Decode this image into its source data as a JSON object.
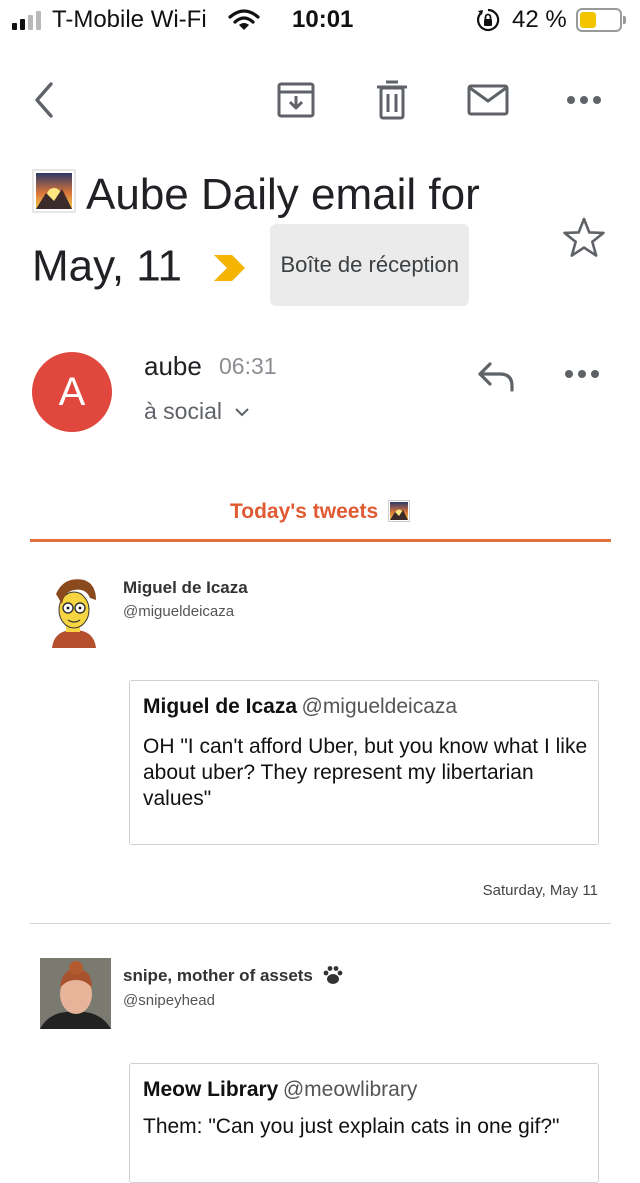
{
  "status_bar": {
    "carrier": "T-Mobile Wi-Fi",
    "time": "10:01",
    "battery": "42 %",
    "battery_level": 0.42,
    "battery_color": "#f5c400"
  },
  "toolbar": {
    "back_icon": "chevron-left-icon",
    "archive_icon": "archive-icon",
    "delete_icon": "trash-icon",
    "mark_unread_icon": "mail-icon",
    "more_icon": "more-horizontal-icon"
  },
  "email": {
    "subject_line1": "Aube Daily email for",
    "subject_line2": "May, 11",
    "label": "Boîte de réception",
    "importance_color": "#f4b400",
    "sender_initial": "A",
    "sender_name": "aube",
    "time": "06:31",
    "recipient": "à social"
  },
  "body": {
    "heading": "Today's tweets",
    "heading_color": "#e05a33",
    "tweets": [
      {
        "name": "Miguel de Icaza",
        "handle": "@migueldeicaza",
        "quote_author": "Miguel de Icaza",
        "quote_handle": "@migueldeicaza",
        "quote_text": "OH \"I can't afford Uber, but you know what I like about uber? They represent my libertarian values\"",
        "date": "Saturday, May 11"
      },
      {
        "name": "snipe, mother of assets",
        "handle": "@snipeyhead",
        "quote_author": "Meow Library",
        "quote_handle": "@meowlibrary",
        "quote_text": "Them: \"Can you just explain cats in one gif?\""
      }
    ]
  }
}
